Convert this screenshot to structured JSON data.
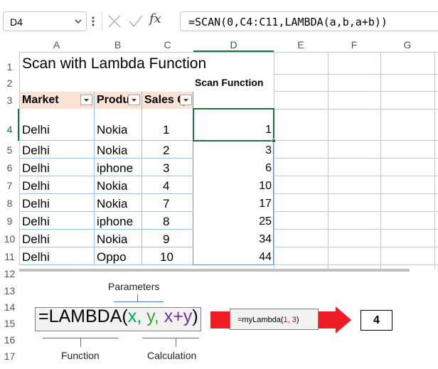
{
  "formula_bar": {
    "name_box": "D4",
    "fx": "fx",
    "formula": "=SCAN(0,C4:C11,LAMBDA(a,b,a+b))"
  },
  "columns": [
    "A",
    "B",
    "C",
    "D",
    "E",
    "F",
    "G"
  ],
  "rows": [
    "1",
    "2",
    "3",
    "4",
    "5",
    "6",
    "7",
    "8",
    "9",
    "10",
    "11",
    "12",
    "13",
    "14",
    "15",
    "16",
    "17"
  ],
  "sheet": {
    "title": "Scan with Lambda Function",
    "scan_header": "Scan Function",
    "table_headers": [
      "Market",
      "Produ",
      "Sales Q"
    ],
    "table_rows": [
      {
        "market": "Delhi",
        "product": "Nokia",
        "qty": "1",
        "scan": "1"
      },
      {
        "market": "Delhi",
        "product": "Nokia",
        "qty": "2",
        "scan": "3"
      },
      {
        "market": "Delhi",
        "product": "iphone",
        "qty": "3",
        "scan": "6"
      },
      {
        "market": "Delhi",
        "product": "Nokia",
        "qty": "4",
        "scan": "10"
      },
      {
        "market": "Delhi",
        "product": "Nokia",
        "qty": "7",
        "scan": "17"
      },
      {
        "market": "Delhi",
        "product": "iphone",
        "qty": "8",
        "scan": "25"
      },
      {
        "market": "Delhi",
        "product": "Nokia",
        "qty": "9",
        "scan": "34"
      },
      {
        "market": "Delhi",
        "product": "Oppo",
        "qty": "10",
        "scan": "44"
      }
    ]
  },
  "diagram": {
    "label_parameters": "Parameters",
    "label_function": "Function",
    "label_calculation": "Calculation",
    "lambda_prefix": "=LAMBDA(",
    "param_x": "x",
    "sep1": ", ",
    "param_y": "y",
    "sep2": ", ",
    "calc": "x+y",
    "lambda_suffix": ")",
    "call_prefix": "=myLambda(",
    "call_args": "1, 3",
    "call_suffix": ")",
    "result": "4",
    "colors": {
      "arrow": "#ee1c25",
      "param": "#00a651",
      "calc": "#7030a0",
      "args": "#c00000",
      "lines": "#4472c4"
    }
  }
}
